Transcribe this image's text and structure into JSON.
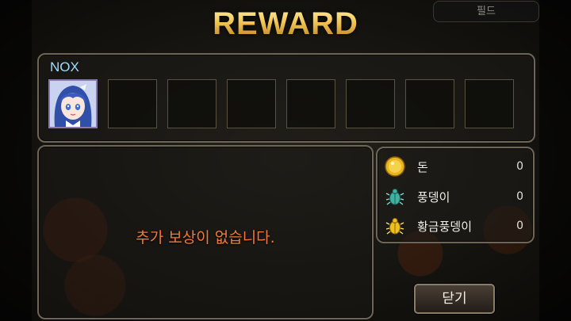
{
  "title": "REWARD",
  "field_tab": "필드",
  "hero": {
    "name": "NOX"
  },
  "message": "추가 보상이 없습니다.",
  "resources": [
    {
      "label": "돈",
      "value": "0",
      "icon": "gold-coin-icon"
    },
    {
      "label": "풍뎅이",
      "value": "0",
      "icon": "beetle-icon"
    },
    {
      "label": "황금풍뎅이",
      "value": "0",
      "icon": "golden-beetle-icon"
    }
  ],
  "close_label": "닫기",
  "colors": {
    "title_gold": "#f2c451",
    "message_orange": "#f07a3a",
    "hero_name_blue": "#9edcff",
    "panel_border": "#6e6556"
  }
}
